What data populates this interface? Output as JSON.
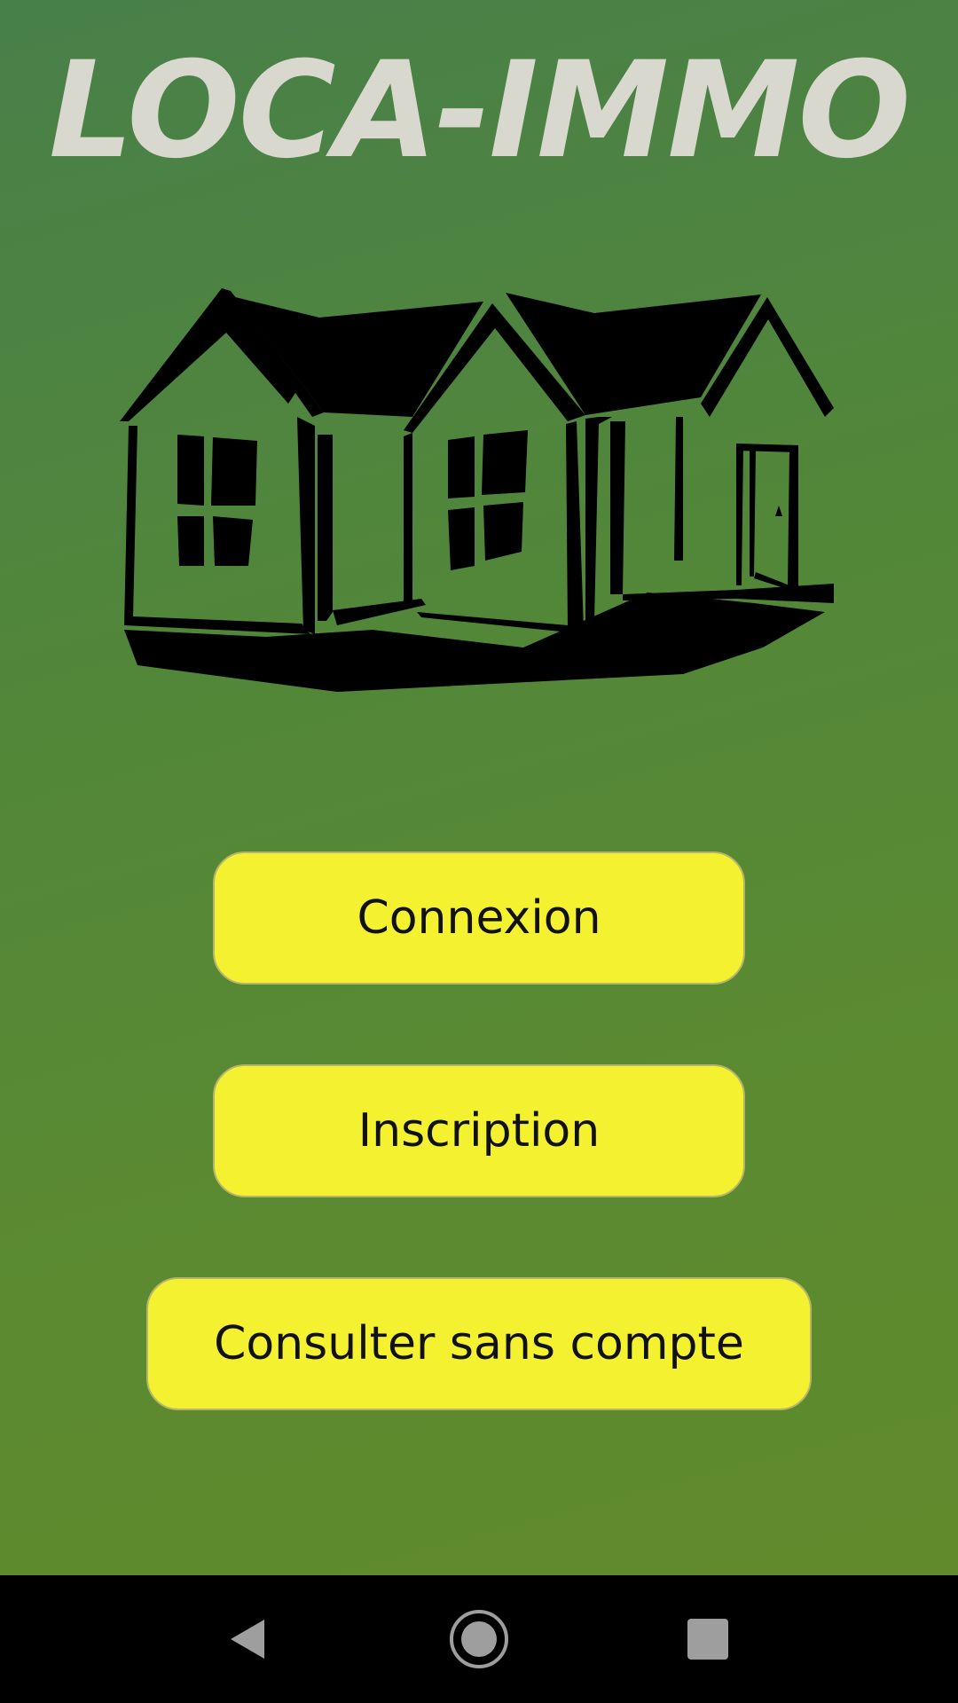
{
  "app": {
    "title": "LOCA-IMMO"
  },
  "illustration": {
    "icon": "house-icon"
  },
  "buttons": {
    "connexion": "Connexion",
    "inscription": "Inscription",
    "consulter": "Consulter sans compte"
  },
  "navigation_bar": {
    "back_icon": "back-triangle-icon",
    "home_icon": "home-circle-icon",
    "recent_icon": "recent-apps-square-icon"
  },
  "colors": {
    "background_top": "#48804a",
    "background_bottom": "#608a2c",
    "title": "#d9d8cf",
    "button": "#f4f230",
    "nav_bar": "#000000",
    "nav_icons": "#9e9e9e"
  }
}
